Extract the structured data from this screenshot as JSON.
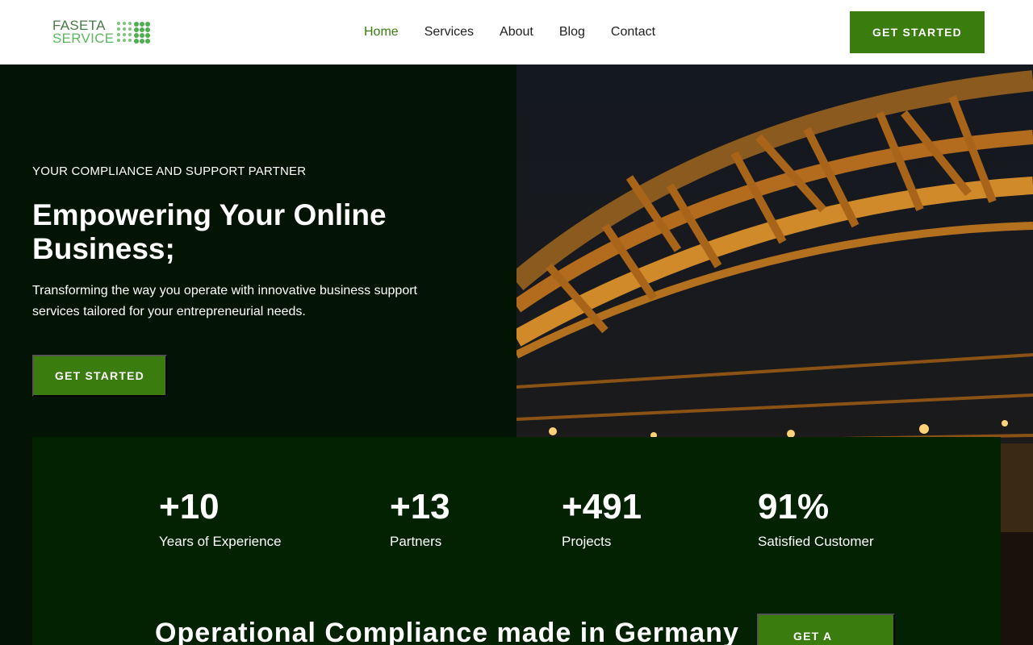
{
  "header": {
    "logo": {
      "line1": "FASETA",
      "line2": "SERVICE"
    },
    "nav": [
      {
        "label": "Home",
        "active": true
      },
      {
        "label": "Services",
        "active": false
      },
      {
        "label": "About",
        "active": false
      },
      {
        "label": "Blog",
        "active": false
      },
      {
        "label": "Contact",
        "active": false
      }
    ],
    "cta_label": "GET STARTED"
  },
  "hero": {
    "eyebrow": "YOUR COMPLIANCE AND SUPPORT PARTNER",
    "title": "Empowering Your Online Business;",
    "subtitle": "Transforming the way you operate with innovative business support services tailored for your entrepreneurial needs.",
    "cta_label": "GET STARTED",
    "image_icon": "bridge-photo"
  },
  "stats": [
    {
      "value": "+10",
      "label": "Years of Experience"
    },
    {
      "value": "+13",
      "label": "Partners"
    },
    {
      "value": "+491",
      "label": "Projects"
    },
    {
      "value": "91%",
      "label": "Satisfied Customer"
    }
  ],
  "bottom": {
    "title": "Operational Compliance made in Germany",
    "cta_label": "GET A",
    "cta_icon": "arrow-right-icon"
  },
  "colors": {
    "accent": "#3a7d0e",
    "hero_bg": "#041404",
    "stats_bg": "#022202",
    "nav_active": "#3a7d0e"
  }
}
